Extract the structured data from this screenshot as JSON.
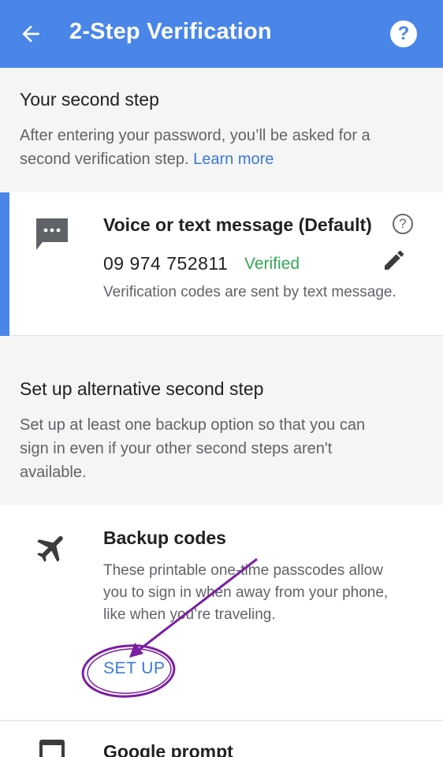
{
  "appbar": {
    "title": "2-Step Verification",
    "help_glyph": "?",
    "color": "#4a86e8"
  },
  "second_step": {
    "title": "Your second step",
    "desc_line1": "After entering your password, you’ll be asked for a",
    "desc_line2": "second verification step.",
    "learn_more": "Learn more"
  },
  "voice_card": {
    "title": "Voice or text message (Default)",
    "help_glyph": "?",
    "phone": "09 974 752811",
    "status": "Verified",
    "status_color": "#34a853",
    "desc": "Verification codes are sent by text message."
  },
  "alternative": {
    "title": "Set up alternative second step",
    "desc_line1": "Set up at least one backup option so that you can",
    "desc_line2": "sign in even if your other second steps aren't",
    "desc_line3": "available."
  },
  "backup_card": {
    "title": "Backup codes",
    "desc_line1": "These printable one-time passcodes allow",
    "desc_line2": "you to sign in when away from your phone,",
    "desc_line3": "like when you’re traveling.",
    "action": "SET UP"
  },
  "google_prompt_card": {
    "title": "Google prompt"
  },
  "annotation": {
    "color": "#7b1fa2",
    "shape": "arrow and ellipse highlighting SET UP"
  }
}
